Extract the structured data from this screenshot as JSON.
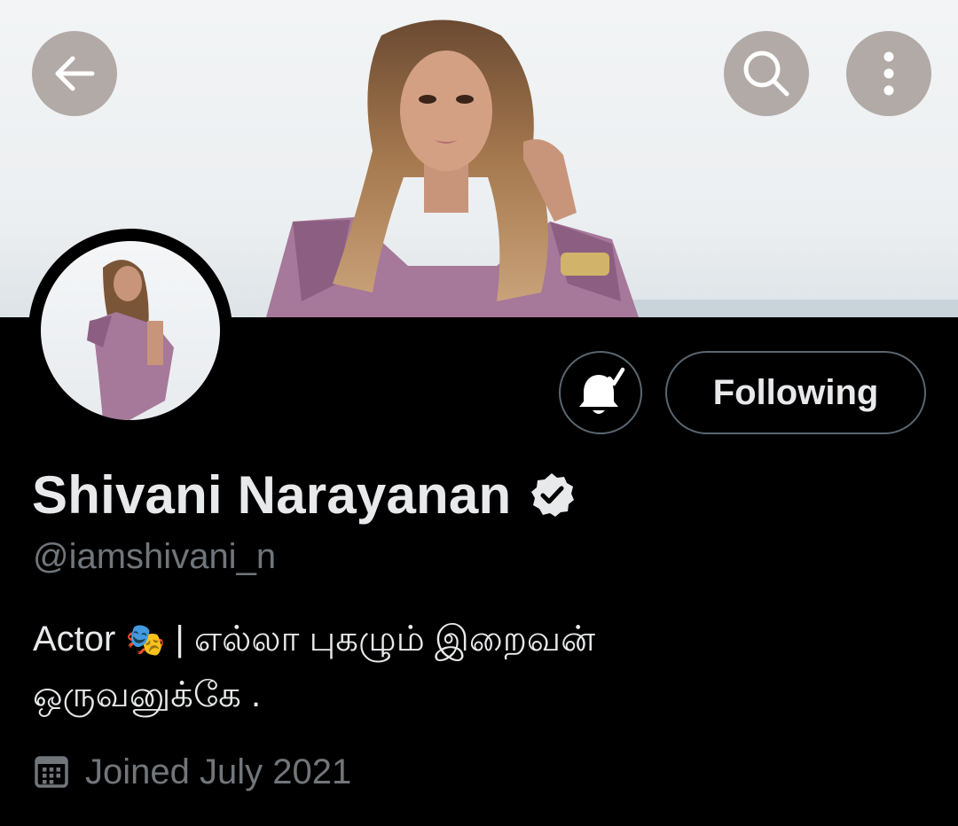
{
  "header": {
    "back_icon": "arrow-left-icon",
    "search_icon": "search-icon",
    "more_icon": "more-vertical-icon"
  },
  "profile": {
    "display_name": "Shivani Narayanan",
    "verified_icon": "verified-badge-icon",
    "handle": "@iamshivani_n",
    "bio_line1_prefix": "Actor ",
    "bio_emoji": "🎭",
    "bio_line1_suffix": " | எல்லா புகழும் இறைவன்",
    "bio_line2": "ஒருவனுக்கே .",
    "joined": "Joined July 2021",
    "joined_icon": "calendar-icon"
  },
  "actions": {
    "notify_icon": "bell-subscribed-icon",
    "follow_label": "Following"
  },
  "colors": {
    "background": "#000000",
    "primary_text": "#e7e9ea",
    "secondary_text": "#71767b",
    "button_border": "#5b6670",
    "overlay_button": "#b2aaa6"
  }
}
